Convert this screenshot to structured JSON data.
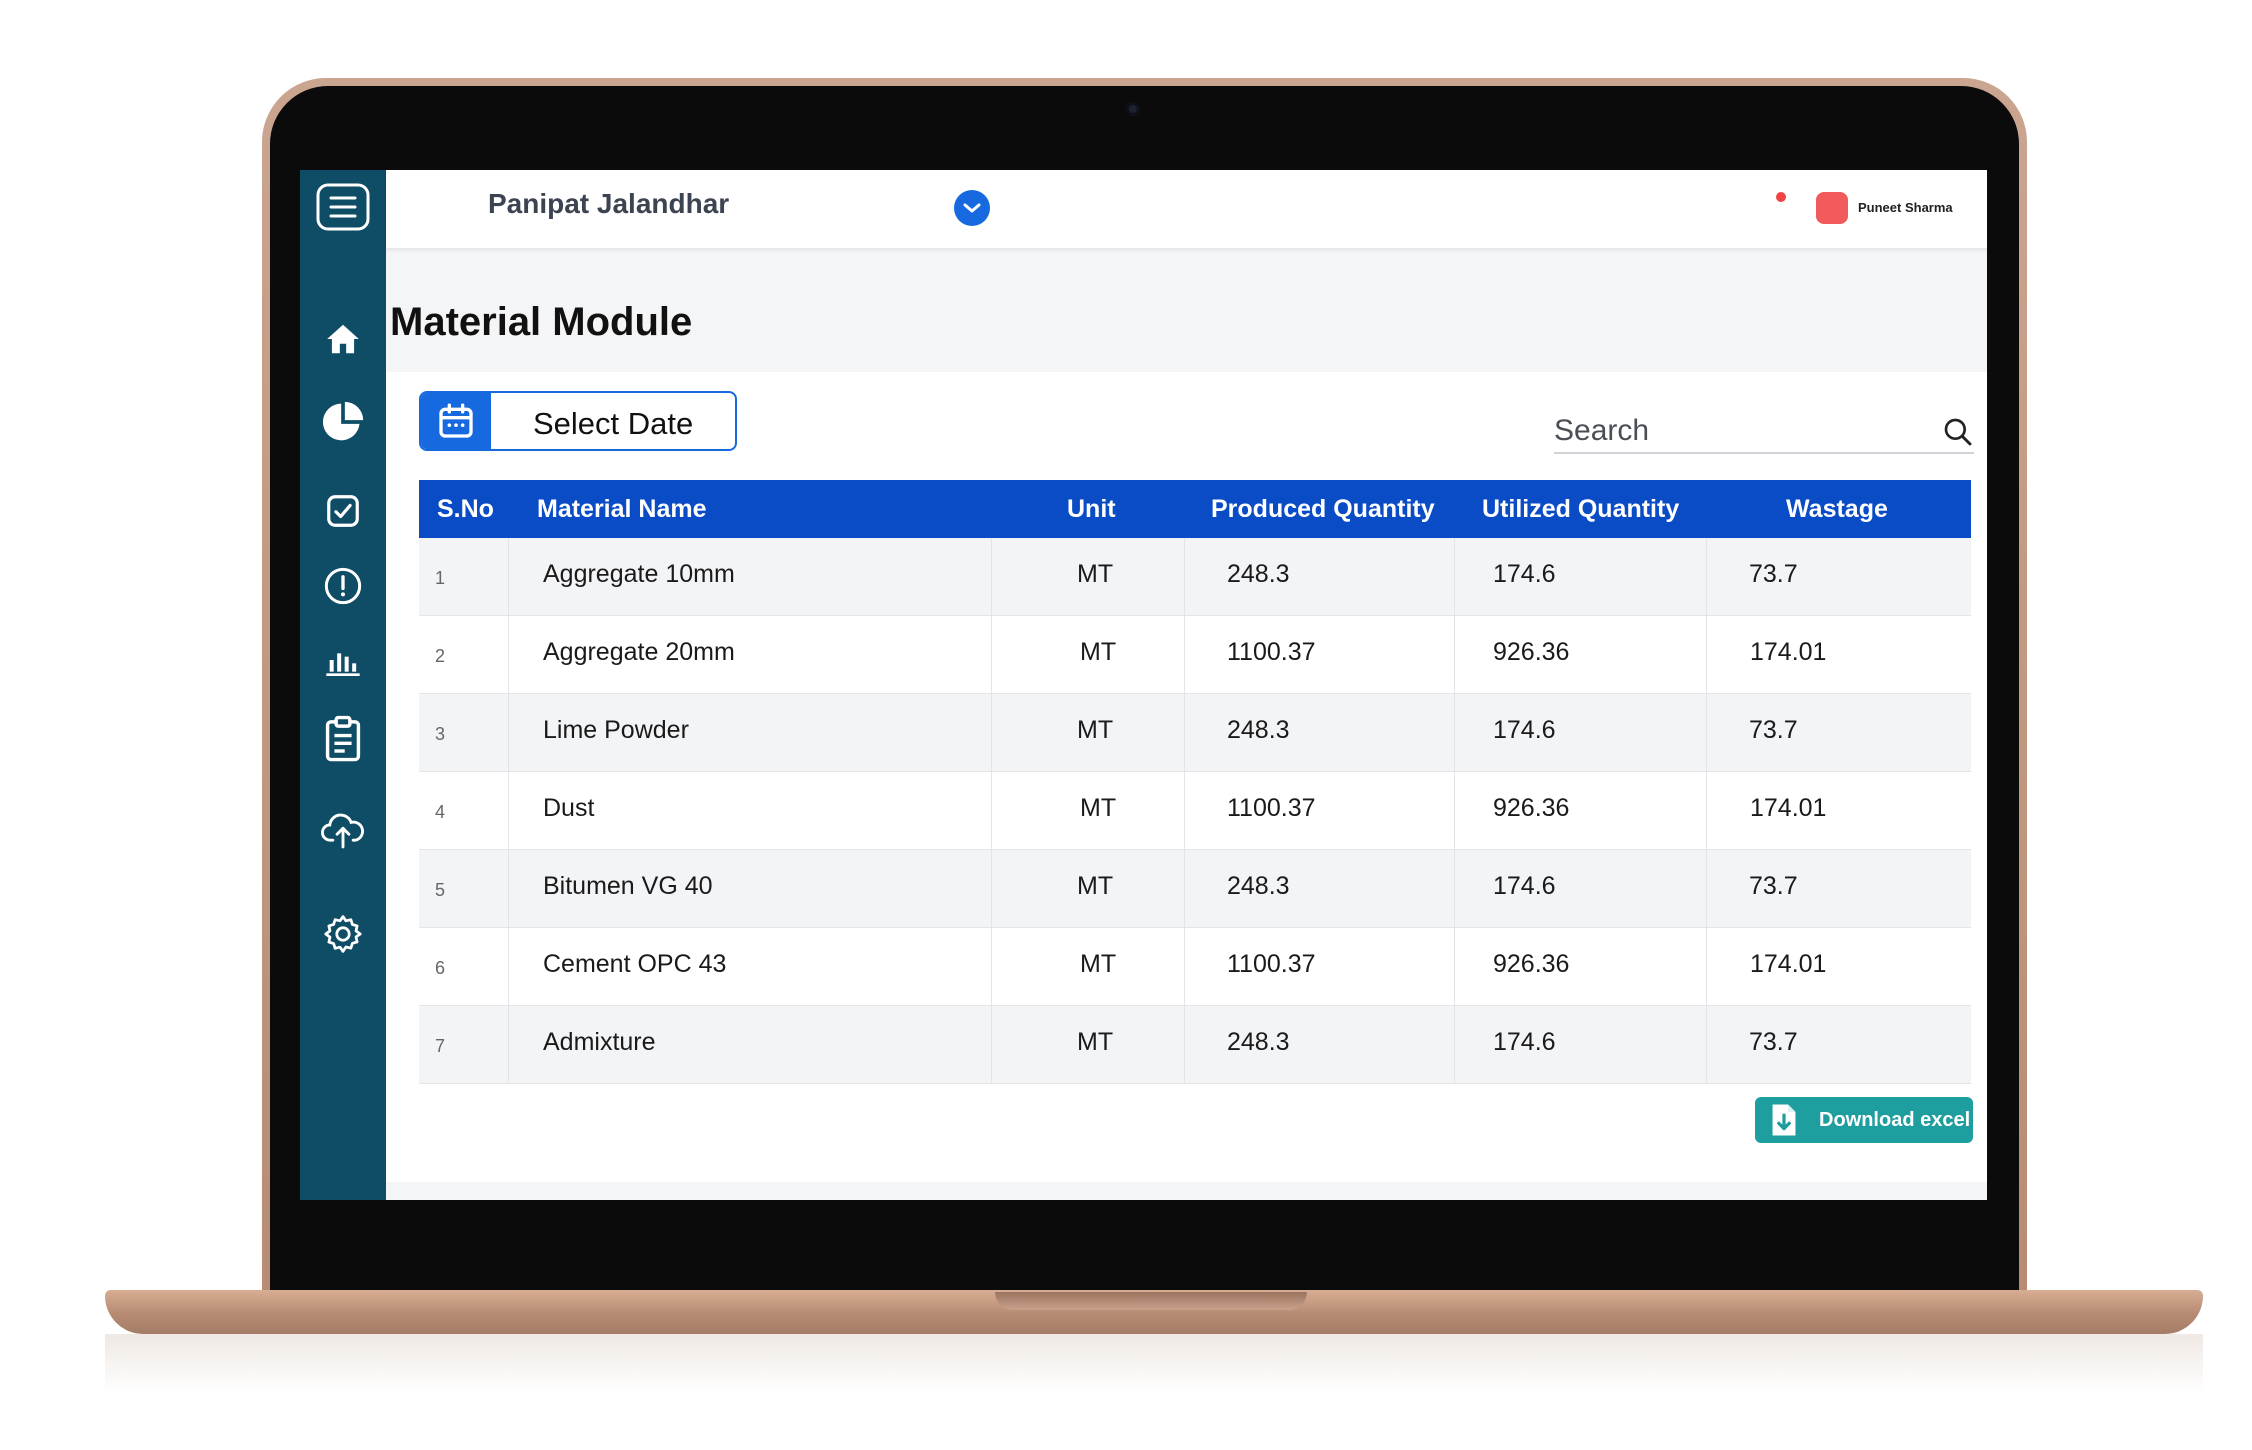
{
  "header": {
    "site_name": "Panipat Jalandhar",
    "user_name": "Puneet Sharma"
  },
  "sidebar": {
    "items": [
      {
        "icon": "menu-icon"
      },
      {
        "icon": "home-icon"
      },
      {
        "icon": "pie-chart-icon"
      },
      {
        "icon": "check-square-icon"
      },
      {
        "icon": "alert-circle-icon"
      },
      {
        "icon": "bar-chart-icon"
      },
      {
        "icon": "clipboard-icon"
      },
      {
        "icon": "cloud-upload-icon"
      },
      {
        "icon": "settings-icon"
      }
    ]
  },
  "page": {
    "title": "Material Module"
  },
  "toolbar": {
    "date_label": "Select Date",
    "search_placeholder": "Search"
  },
  "table": {
    "columns": [
      "S.No",
      "Material Name",
      "Unit",
      "Produced Quantity",
      "Utilized Quantity",
      "Wastage"
    ],
    "rows": [
      {
        "sno": "1",
        "name": "Aggregate 10mm",
        "unit": "MT",
        "produced": "248.3",
        "utilized": "174.6",
        "wastage": "73.7"
      },
      {
        "sno": "2",
        "name": "Aggregate 20mm",
        "unit": "MT",
        "produced": "1100.37",
        "utilized": "926.36",
        "wastage": "174.01"
      },
      {
        "sno": "3",
        "name": "Lime Powder",
        "unit": "MT",
        "produced": "248.3",
        "utilized": "174.6",
        "wastage": "73.7"
      },
      {
        "sno": "4",
        "name": "Dust",
        "unit": "MT",
        "produced": "1100.37",
        "utilized": "926.36",
        "wastage": "174.01"
      },
      {
        "sno": "5",
        "name": "Bitumen VG 40",
        "unit": "MT",
        "produced": "248.3",
        "utilized": "174.6",
        "wastage": "73.7"
      },
      {
        "sno": "6",
        "name": "Cement OPC 43",
        "unit": "MT",
        "produced": "1100.37",
        "utilized": "926.36",
        "wastage": "174.01"
      },
      {
        "sno": "7",
        "name": "Admixture",
        "unit": "MT",
        "produced": "248.3",
        "utilized": "174.6",
        "wastage": "73.7"
      }
    ]
  },
  "footer": {
    "download_label": "Download excel"
  },
  "colors": {
    "sidebar": "#0f4c66",
    "table_header": "#0a4bc6",
    "accent": "#1769e0",
    "download": "#1f9e9f",
    "notification": "#ef4444"
  }
}
